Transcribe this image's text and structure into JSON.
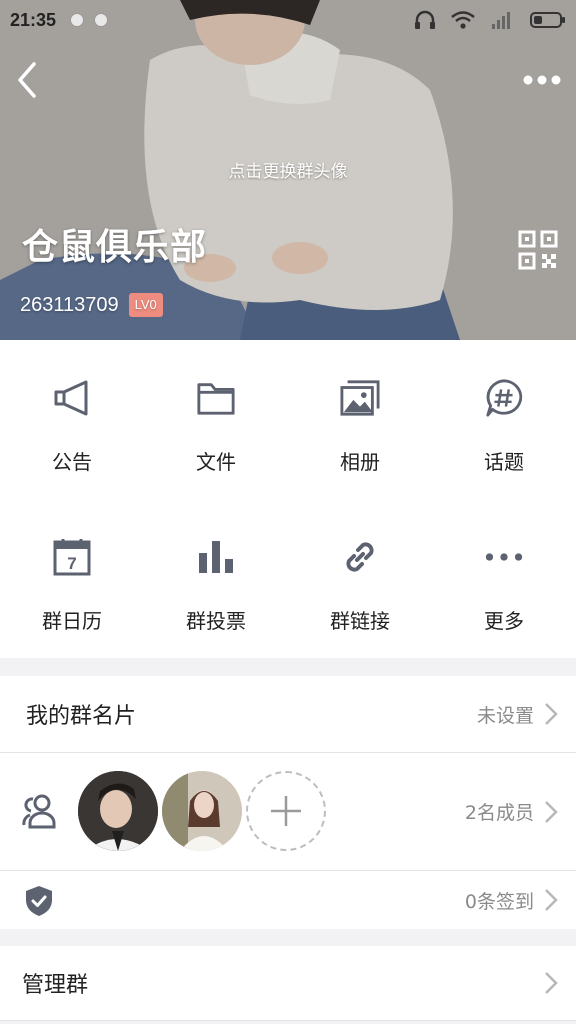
{
  "status_bar": {
    "time": "21:35"
  },
  "header": {
    "change_avatar_hint": "点击更换群头像",
    "group_name": "仓鼠俱乐部",
    "group_id": "263113709",
    "level_badge": "LV0"
  },
  "functions": [
    {
      "label": "公告",
      "icon": "megaphone-icon"
    },
    {
      "label": "文件",
      "icon": "folder-icon"
    },
    {
      "label": "相册",
      "icon": "photo-album-icon"
    },
    {
      "label": "话题",
      "icon": "topic-hashtag-icon"
    },
    {
      "label": "群日历",
      "icon": "calendar-icon",
      "calendar_day": "7"
    },
    {
      "label": "群投票",
      "icon": "bar-chart-vote-icon"
    },
    {
      "label": "群链接",
      "icon": "link-icon"
    },
    {
      "label": "更多",
      "icon": "more-dots-icon"
    }
  ],
  "my_card": {
    "title": "我的群名片",
    "value": "未设置"
  },
  "members": {
    "count_text": "2名成员"
  },
  "checkin": {
    "value": "0条签到"
  },
  "manage": {
    "title": "管理群"
  },
  "colors": {
    "icon_gray": "#5d6270",
    "badge": "#ef8c80",
    "secondary_text": "#8a8a8a"
  }
}
